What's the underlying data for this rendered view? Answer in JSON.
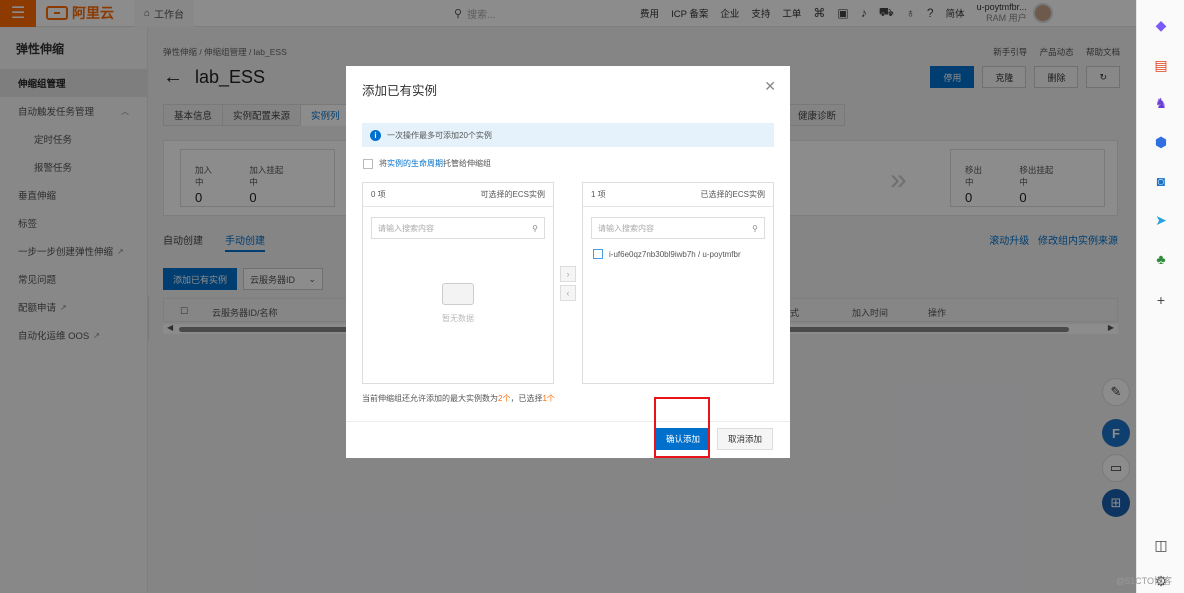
{
  "topbar": {
    "brand": "阿里云",
    "workbench": "工作台",
    "search_placeholder": "搜索...",
    "nav": [
      "费用",
      "ICP 备案",
      "企业",
      "支持",
      "工单"
    ],
    "lang": "简体",
    "user_name": "u-poytmfbr...",
    "user_role": "RAM 用户"
  },
  "sidebar": {
    "title": "弹性伸缩",
    "items": [
      {
        "label": "伸缩组管理"
      },
      {
        "label": "自动触发任务管理"
      },
      {
        "label": "定时任务"
      },
      {
        "label": "报警任务"
      },
      {
        "label": "垂直伸缩"
      },
      {
        "label": "标签"
      },
      {
        "label": "一步一步创建弹性伸缩"
      },
      {
        "label": "常见问题"
      },
      {
        "label": "配额申请"
      },
      {
        "label": "自动化运维 OOS"
      }
    ]
  },
  "main": {
    "breadcrumb": "弹性伸缩 / 伸缩组管理 / lab_ESS",
    "toplinks": [
      "新手引导",
      "产品动态",
      "帮助文档"
    ],
    "title": "lab_ESS",
    "actions": [
      "停用",
      "克隆",
      "删除"
    ],
    "tabs": [
      "基本信息",
      "实例配置来源",
      "实例列"
    ],
    "tab_right": "健康诊断",
    "stats_left": [
      {
        "label": "加入中",
        "value": "0"
      },
      {
        "label": "加入挂起中",
        "value": "0"
      }
    ],
    "stats_right": [
      {
        "label": "移出中",
        "value": "0"
      },
      {
        "label": "移出挂起中",
        "value": "0"
      }
    ],
    "subtabs": [
      "自动创建",
      "手动创建"
    ],
    "right_links": [
      "滚动升级",
      "修改组内实例来源"
    ],
    "add_button": "添加已有实例",
    "filter_select": "云服务器ID",
    "table_headers": [
      "云服务器ID/名称",
      "式",
      "加入时间",
      "操作"
    ]
  },
  "modal": {
    "title": "添加已有实例",
    "notice": "一次操作最多可添加20个实例",
    "lifecycle_prefix": "将",
    "lifecycle_link": "实例的生命周期",
    "lifecycle_suffix": "托管给伸缩组",
    "left_panel": {
      "count": "0 项",
      "title": "可选择的ECS实例",
      "search_placeholder": "请输入搜索内容",
      "empty": "暂无数据"
    },
    "right_panel": {
      "count": "1 项",
      "title": "已选择的ECS实例",
      "search_placeholder": "请输入搜索内容",
      "items": [
        "i-uf6e0qz7nb30bl9iwb7h / u-poytmfbr"
      ]
    },
    "limit_text_a": "当前伸缩组还允许添加的最大实例数为",
    "limit_num": "2个",
    "limit_text_b": "，已选择",
    "limit_sel": "1个",
    "confirm": "确认添加",
    "cancel": "取消添加"
  },
  "watermark": "@51CTO博客",
  "colors": {
    "accent": "#0070cc",
    "brand": "#ff6a00",
    "highlight": "#e8141c"
  }
}
